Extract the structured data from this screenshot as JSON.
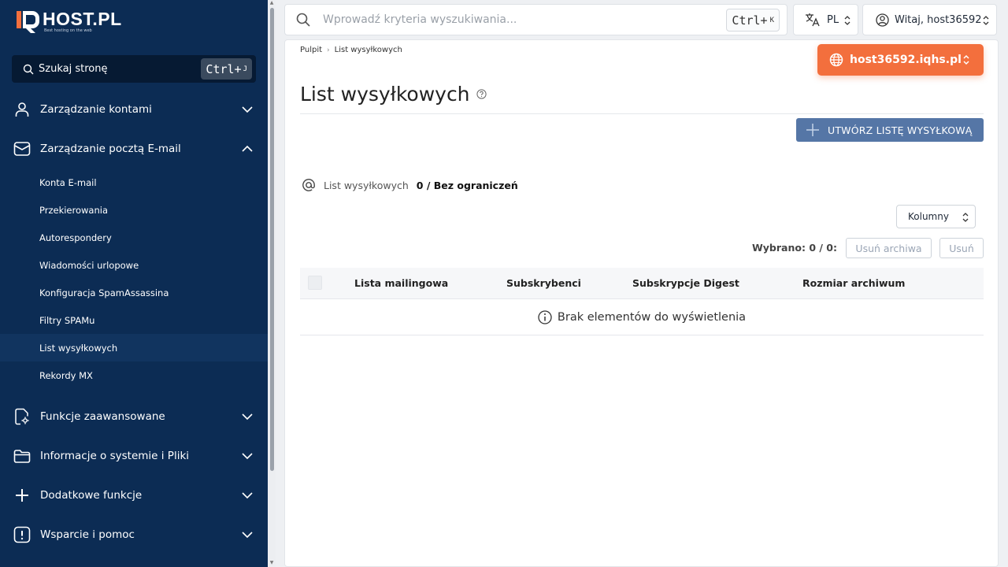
{
  "brand": {
    "name": "HOST.PL",
    "tagline": "Best hosting on the web",
    "accent": "#f36f3d",
    "sidebar_bg": "#0c2c54"
  },
  "sidebar": {
    "search": {
      "label": "Szukaj stronę",
      "shortcut_main": "Ctrl+",
      "shortcut_key": "J"
    },
    "groups": [
      {
        "label": "Zarządzanie kontami",
        "icon": "user-icon",
        "expanded": false
      },
      {
        "label": "Zarządzanie pocztą E-mail",
        "icon": "mail-icon",
        "expanded": true
      },
      {
        "label": "Funkcje zaawansowane",
        "icon": "advanced-settings-icon",
        "expanded": false
      },
      {
        "label": "Informacje o systemie i Pliki",
        "icon": "folder-icon",
        "expanded": false
      },
      {
        "label": "Dodatkowe funkcje",
        "icon": "plus-icon",
        "expanded": false
      },
      {
        "label": "Wsparcie i pomoc",
        "icon": "alert-icon",
        "expanded": false
      }
    ],
    "email_items": [
      {
        "label": "Konta E-mail",
        "active": false
      },
      {
        "label": "Przekierowania",
        "active": false
      },
      {
        "label": "Autorespondery",
        "active": false
      },
      {
        "label": "Wiadomości urlopowe",
        "active": false
      },
      {
        "label": "Konfiguracja SpamAssassina",
        "active": false
      },
      {
        "label": "Filtry SPAMu",
        "active": false
      },
      {
        "label": "List wysyłkowych",
        "active": true
      },
      {
        "label": "Rekordy MX",
        "active": false
      }
    ]
  },
  "topbar": {
    "search_placeholder": "Wprowadź kryteria wyszukiwania...",
    "shortcut_main": "Ctrl+",
    "shortcut_key": "K",
    "language": "PL",
    "user_greeting": "Witaj, host36592"
  },
  "main": {
    "breadcrumb": [
      "Pulpit",
      "List wysyłkowych"
    ],
    "host_button": "host36592.iqhs.pl",
    "title": "List wysyłkowych",
    "create_button": "UTWÓRZ LISTĘ WYSYŁKOWĄ",
    "stat_label": "List wysyłkowych",
    "stat_value": "0 / Bez ograniczeń",
    "columns_button": "Kolumny",
    "selected_label": "Wybrano: 0 / 0:",
    "delete_archives_button": "Usuń archiwa",
    "delete_button": "Usuń",
    "table_headers": [
      "Lista mailingowa",
      "Subskrybenci",
      "Subskrypcje Digest",
      "Rozmiar archiwum"
    ],
    "empty_message": "Brak elementów do wyświetlenia"
  }
}
